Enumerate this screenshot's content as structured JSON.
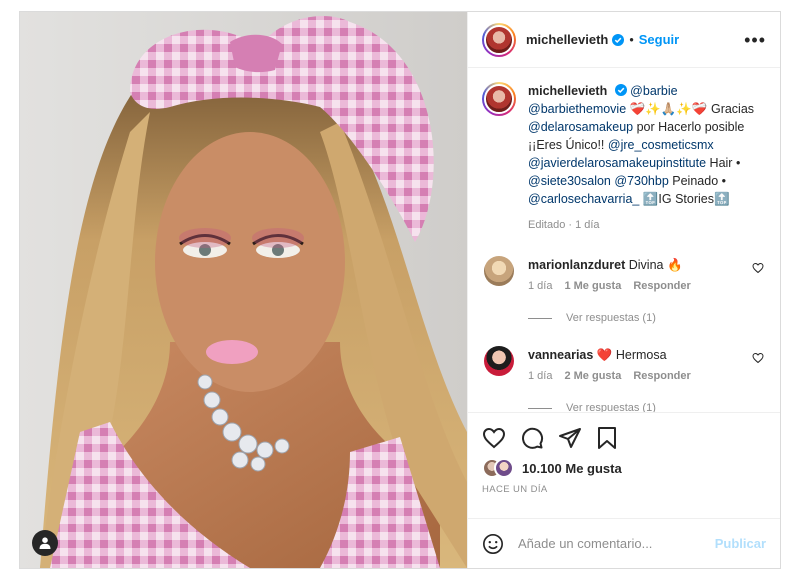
{
  "post": {
    "username": "michellevieth",
    "follow_label": "Seguir",
    "more_label": "•••",
    "dot": "•"
  },
  "caption": {
    "username": "michellevieth",
    "m_barbie": "@barbie",
    "m_barbiethemovie": "@barbiethemovie",
    "emojis_1": "❤️‍🩹✨🙏🏼✨❤️‍🩹",
    "gracias": "Gracias",
    "m_delarosa": "@delarosamakeup",
    "por": "por",
    "hacerlo": "Hacerlo posible ¡¡Eres Único!!",
    "m_jre": "@jre_cosmeticsmx",
    "m_javier": "@javierdelarosamakeupinstitute",
    "hair": "Hair •",
    "m_siete": "@siete30salon",
    "m_730": "@730hbp",
    "peinado": "Peinado •",
    "m_carlos": "@carlosechavarria_",
    "top_1": "🔝",
    "ig_stories": "IG Stories",
    "top_2": "🔝",
    "meta": "Editado · 1 día"
  },
  "comments": [
    {
      "username": "marionlanzduret",
      "text": "Divina",
      "emoji": "🔥",
      "time": "1 día",
      "likes": "1 Me gusta",
      "reply": "Responder",
      "view_replies": "Ver respuestas (1)"
    },
    {
      "username": "vannearias",
      "emoji": "❤️",
      "text": "Hermosa",
      "time": "1 día",
      "likes": "2 Me gusta",
      "reply": "Responder",
      "view_replies": "Ver respuestas (1)"
    }
  ],
  "stats": {
    "likes": "10.100 Me gusta",
    "time_ago": "HACE UN DÍA"
  },
  "composer": {
    "placeholder": "Añade un comentario...",
    "publish": "Publicar"
  },
  "colors": {
    "accent": "#0095f6",
    "mention": "#00376b",
    "muted": "#8e8e8e",
    "border": "#dbdbdb"
  },
  "icons": [
    "heart-icon",
    "comment-icon",
    "share-icon",
    "bookmark-icon",
    "smile-icon",
    "verified-icon",
    "more-icon",
    "user-tag-icon"
  ]
}
